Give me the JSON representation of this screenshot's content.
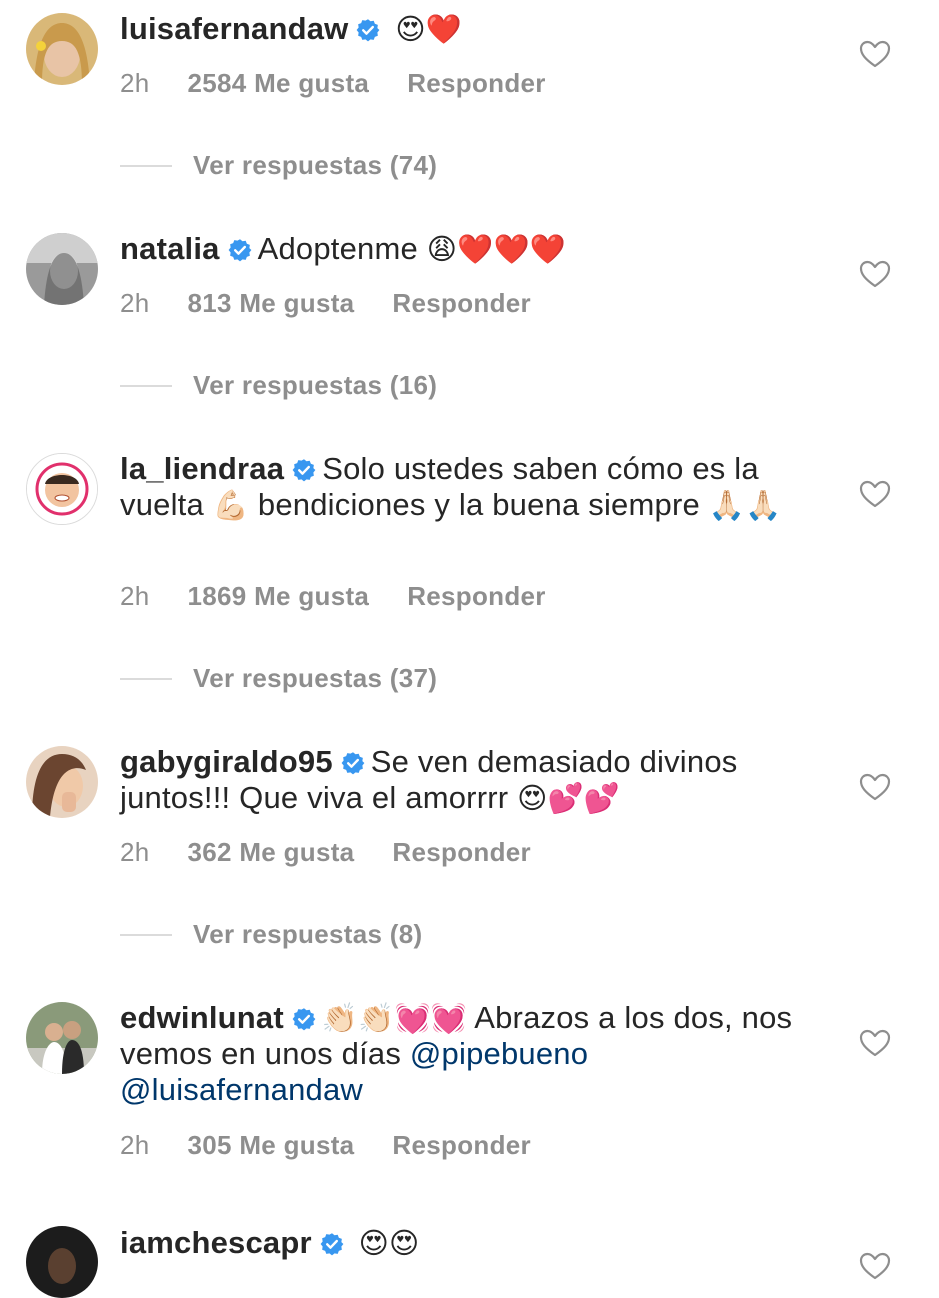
{
  "comments": [
    {
      "username": "luisafernandaw",
      "text": "",
      "emojis": "😍❤️",
      "time": "2h",
      "likes": "2584 Me gusta",
      "reply": "Responder",
      "replies": "Ver respuestas (74)"
    },
    {
      "username": "natalia",
      "text": "Adoptenme",
      "emojis": "😩❤️❤️❤️",
      "time": "2h",
      "likes": "813 Me gusta",
      "reply": "Responder",
      "replies": "Ver respuestas (16)"
    },
    {
      "username": "la_liendraa",
      "text_a": "Solo ustedes saben cómo es la vuelta",
      "emoji_a": "💪🏻",
      "text_b": "bendiciones y la buena siempre",
      "emoji_b": "🙏🏻🙏🏻",
      "time": "2h",
      "likes": "1869 Me gusta",
      "reply": "Responder",
      "replies": "Ver respuestas (37)"
    },
    {
      "username": "gabygiraldo95",
      "text": "Se ven demasiado divinos juntos!!! Que viva el amorrrr",
      "emojis": "😍💕💕",
      "time": "2h",
      "likes": "362 Me gusta",
      "reply": "Responder",
      "replies": "Ver respuestas (8)"
    },
    {
      "username": "edwinlunat",
      "emojis": "👏🏻👏🏻💓💓",
      "text": "Abrazos a los dos, nos vemos en unos días",
      "mention1": "@pipebueno",
      "mention2": "@luisafernandaw",
      "time": "2h",
      "likes": "305 Me gusta",
      "reply": "Responder"
    },
    {
      "username": "iamchescapr",
      "emojis": "😍😍"
    }
  ],
  "colors": {
    "text": "#262626",
    "meta": "#8e8e8e",
    "verified": "#3897f0",
    "mention": "#00376b",
    "divider": "#dbdbdb"
  },
  "icons": [
    "verified-badge-icon",
    "heart-outline-icon",
    "avatar"
  ]
}
